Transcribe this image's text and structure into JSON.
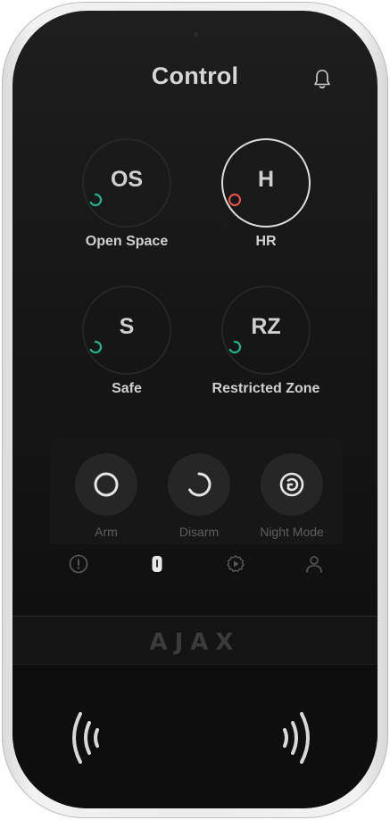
{
  "header": {
    "title": "Control",
    "bell_icon": "bell-icon"
  },
  "groups": [
    {
      "abbr": "OS",
      "name": "Open Space",
      "state": "disarmed",
      "status_color": "#1fb890",
      "highlighted": false
    },
    {
      "abbr": "H",
      "name": "HR",
      "state": "armed",
      "status_color": "#e0534b",
      "highlighted": true
    },
    {
      "abbr": "S",
      "name": "Safe",
      "state": "disarmed",
      "status_color": "#1fb890",
      "highlighted": false
    },
    {
      "abbr": "RZ",
      "name": "Restricted Zone",
      "state": "disarmed",
      "status_color": "#1fb890",
      "highlighted": false
    }
  ],
  "modes": [
    {
      "label": "Arm",
      "icon": "arm-circle-icon"
    },
    {
      "label": "Disarm",
      "icon": "disarm-open-circle-icon"
    },
    {
      "label": "Night Mode",
      "icon": "night-mode-icon"
    }
  ],
  "nav": [
    {
      "id": "alarm",
      "icon": "alert-circle-icon",
      "active": false
    },
    {
      "id": "control",
      "icon": "keypad-icon",
      "active": true
    },
    {
      "id": "settings",
      "icon": "gear-icon",
      "active": false
    },
    {
      "id": "user",
      "icon": "user-icon",
      "active": false
    }
  ],
  "brand": {
    "logo_text": "AJAX"
  },
  "colors": {
    "armed": "#e0534b",
    "disarmed": "#1fb890",
    "screen": "#161616",
    "frame": "#ececec"
  }
}
